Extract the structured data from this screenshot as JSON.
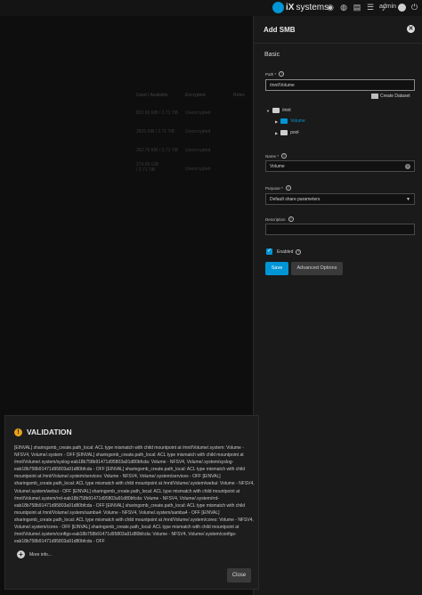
{
  "topbar": {
    "brand": "systems",
    "brand_prefix": "iX",
    "admin": "admin"
  },
  "background": {
    "headers": [
      "Used / Available",
      "Encrypted",
      "Roles"
    ],
    "rows": [
      {
        "usage": "822.96 KiB / 2.71 TiB",
        "enc": "Unencrypted"
      },
      {
        "usage": "2826 KiB / 2.71 TiB",
        "enc": "Unencrypted"
      },
      {
        "usage": "352.76 KiB / 2.71 TiB",
        "enc": "Unencrypted"
      },
      {
        "usage": "274.95 GiB / 2.71 TiB",
        "enc": "Unencrypted"
      }
    ]
  },
  "panel": {
    "title": "Add SMB",
    "section": "Basic",
    "path_label": "Path *",
    "path_value": "/mnt/Volume",
    "create_dataset": "Create Dataset",
    "tree": {
      "root": "/mnt",
      "children": [
        "Volume",
        "pool"
      ]
    },
    "name_label": "Name *",
    "name_value": "Volume",
    "purpose_label": "Purpose *",
    "purpose_value": "Default share parameters",
    "description_label": "Description",
    "description_value": "",
    "enabled_label": "Enabled",
    "save": "Save",
    "advanced": "Advanced Options"
  },
  "modal": {
    "title": "VALIDATION",
    "body": "[EINVAL] sharingsmb_create.path_local: ACL type mismatch with child mountpoint at /mnt/Volume/.system: Volume - NFSV4, Volume/.system - OFF [EINVAL] sharingsmb_create.path_local: ACL type mismatch with child mountpoint at /mnt/Volume/.system/syslog-eab18b758b91471d95803a91d80bfcda: Volume - NFSV4, Volume/.system/syslog-eab18b758b91471d95803a91d80bfcda - OFF [EINVAL] sharingsmb_create.path_local: ACL type mismatch with child mountpoint at /mnt/Volume/.system/services: Volume - NFSV4, Volume/.system/services - OFF [EINVAL] sharingsmb_create.path_local: ACL type mismatch with child mountpoint at /mnt/Volume/.system/webui: Volume - NFSV4, Volume/.system/webui - OFF [EINVAL] sharingsmb_create.path_local: ACL type mismatch with child mountpoint at /mnt/Volume/.system/rrd-eab18b758b91471d95803a91d80bfcda: Volume - NFSV4, Volume/.system/rrd-eab18b758b91471d95803a91d80bfcda - OFF [EINVAL] sharingsmb_create.path_local: ACL type mismatch with child mountpoint at /mnt/Volume/.system/samba4: Volume - NFSV4, Volume/.system/samba4 - OFF [EINVAL] sharingsmb_create.path_local: ACL type mismatch with child mountpoint at /mnt/Volume/.system/cores: Volume - NFSV4, Volume/.system/cores - OFF [EINVAL] sharingsmb_create.path_local: ACL type mismatch with child mountpoint at /mnt/Volume/.system/configs-eab18b758b91471d95803a91d80bfcda: Volume - NFSV4, Volume/.system/configs-eab18b758b91471d95803a91d80bfcda - OFF",
    "more_info": "More info...",
    "close": "Close"
  },
  "colors": {
    "accent": "#0095d5",
    "warning": "#e8a21a"
  }
}
